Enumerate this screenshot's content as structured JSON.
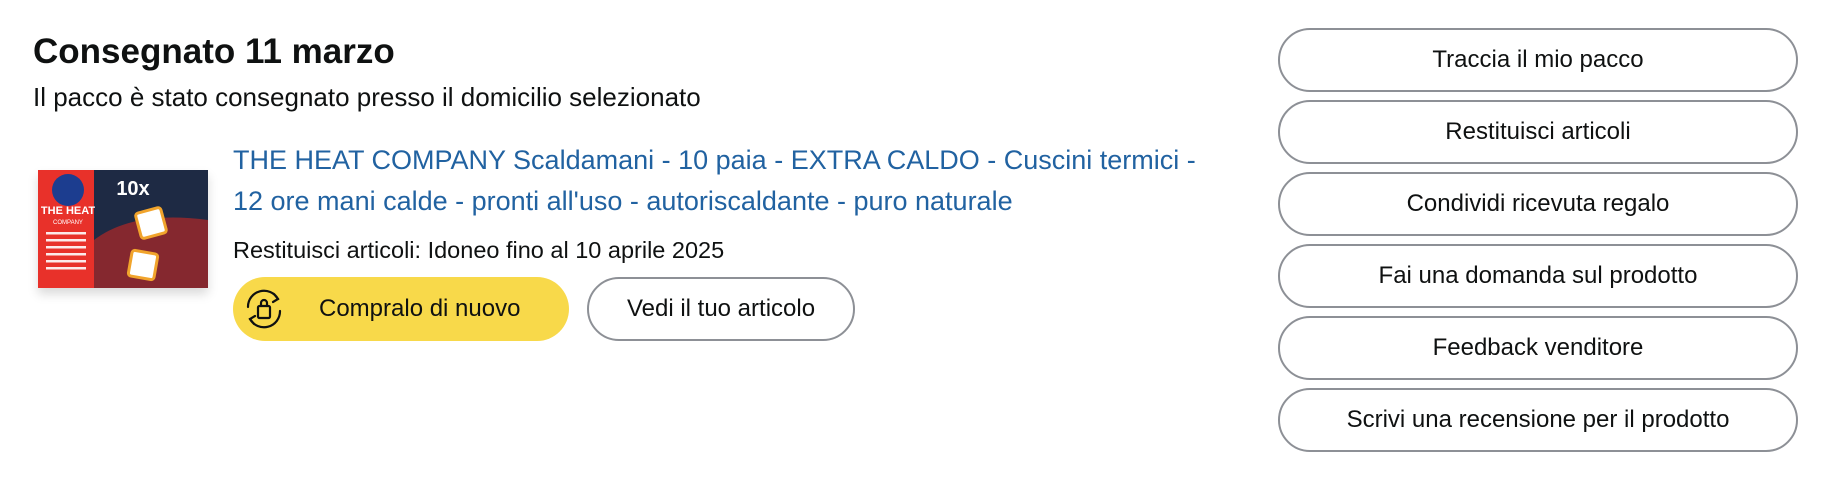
{
  "delivery": {
    "title": "Consegnato 11 marzo",
    "subtitle": "Il pacco è stato consegnato presso il domicilio selezionato"
  },
  "product": {
    "title": "THE HEAT COMPANY Scaldamani - 10 paia - EXTRA CALDO - Cuscini termici - 12 ore mani calde - pronti all'uso - autoriscaldante - puro naturale",
    "return_info": "Restituisci articoli: Idoneo fino al 10 aprile 2025",
    "image": {
      "brand_text": "THE HEAT",
      "brand_sub": "COMPANY",
      "pack_count": "10x"
    }
  },
  "buttons": {
    "buy_again": "Compralo di nuovo",
    "view_item": "Vedi il tuo articolo"
  },
  "actions": [
    {
      "label": "Traccia il mio pacco"
    },
    {
      "label": "Restituisci articoli"
    },
    {
      "label": "Condividi ricevuta regalo"
    },
    {
      "label": "Fai una domanda sul prodotto"
    },
    {
      "label": "Feedback venditore"
    },
    {
      "label": "Scrivi una recensione per il prodotto"
    }
  ],
  "colors": {
    "link": "#2162a1",
    "buy_again_bg": "#f8d94a",
    "border": "#8d9096",
    "product_red": "#e8312a"
  },
  "icons": {
    "buy_again": "reorder-bag-icon"
  }
}
